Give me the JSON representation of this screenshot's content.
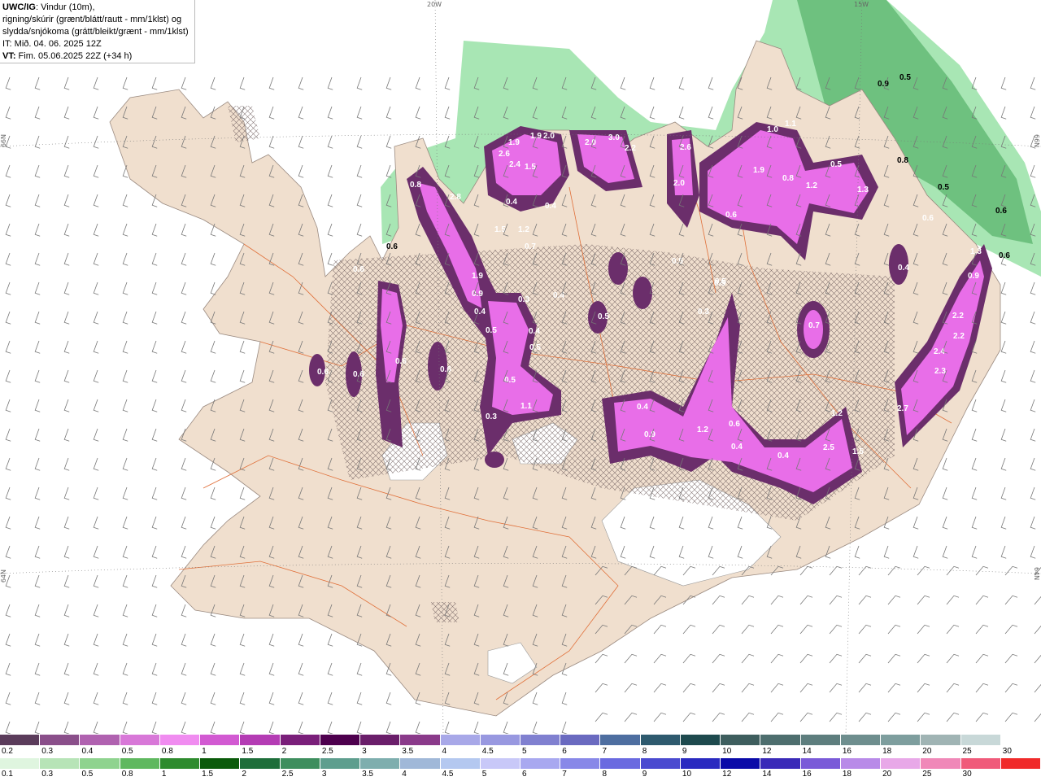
{
  "title": {
    "model": "UWC/IG",
    "line1_rest": ": Vindur (10m),",
    "line2": "rigning/skúrir (grænt/blátt/rautt - mm/1klst) og",
    "line3": "slydda/snjókoma (grátt/bleikt/grænt - mm/1klst)",
    "line4": "IT: Mið. 04. 06. 2025 12Z",
    "line5_label": "VT:",
    "line5_rest": " Fim. 05.06.2025 22Z (+34 h)"
  },
  "coords": {
    "top_20w": "20W",
    "top_15w": "15W",
    "left_66n": "66N",
    "right_66n": "66N",
    "left_64n": "64N",
    "right_64n": "64N"
  },
  "colors": {
    "sea": "#ffffff",
    "land": "#f0dfce",
    "glacier": "#ffffff",
    "roads": "#e0703a",
    "rain_light": "#a8e6b4",
    "rain_mid": "#5fb872",
    "snow_dark": "#6b2e6b",
    "snow_mid": "#a63aa6",
    "snow_light": "#e86ee8"
  },
  "precip_labels": [
    "2.6",
    "1.9",
    "1.9",
    "2.4",
    "1.5",
    "2.0",
    "2.0",
    "3.0",
    "2.2",
    "2.6",
    "2.0",
    "1.0",
    "1.1",
    "1.9",
    "1.2",
    "1.3",
    "0.8",
    "2.8",
    "1.5",
    "1.2",
    "0.7",
    "1.9",
    "0.4",
    "0.4",
    "0.3",
    "0.4",
    "0.5",
    "0.4",
    "0.4",
    "0.5",
    "0.5",
    "0.5",
    "0.5",
    "1.1",
    "0.3",
    "0.4",
    "0.9",
    "1.2",
    "0.6",
    "0.4",
    "2.5",
    "1.5",
    "1.2",
    "2.7",
    "2.3",
    "2.2",
    "2.2",
    "2.4",
    "1.3",
    "0.9",
    "0.6",
    "0.4",
    "0.7",
    "0.3",
    "0.6",
    "0.6",
    "0.6",
    "0.6",
    "0.6",
    "0.4",
    "0.5",
    "0.5",
    "0.5",
    "0.9",
    "0.8",
    "0.6"
  ],
  "sea_labels": [
    "0.5",
    "0.9",
    "0.8",
    "0.5",
    "0.6",
    "0.6",
    "0.6"
  ],
  "legend_snow": {
    "colors": [
      "#5b3c5b",
      "#8a4f8a",
      "#b062b0",
      "#d878d8",
      "#f08cf0",
      "#d25ad2",
      "#b43cb4",
      "#7a1f7a",
      "#4e004e",
      "#6a1e6a",
      "#8a3a8a",
      "#a8a8e8",
      "#9898e0",
      "#8080d0",
      "#6a6ac0",
      "#4e6ea0",
      "#2e5a6e",
      "#1e4a4e",
      "#3e5e5e",
      "#4e6e6e",
      "#5e7e7e",
      "#6e8e8e",
      "#7e9e9e",
      "#a0b4b4",
      "#c8d8d8",
      "#ffffff"
    ],
    "ticks": [
      "0.2",
      "0.3",
      "0.4",
      "0.5",
      "0.8",
      "1",
      "1.5",
      "2",
      "2.5",
      "3",
      "3.5",
      "4",
      "4.5",
      "5",
      "6",
      "7",
      "8",
      "9",
      "10",
      "12",
      "14",
      "16",
      "18",
      "20",
      "25",
      "30"
    ]
  },
  "legend_rain": {
    "colors": [
      "#dff5df",
      "#b7e4b7",
      "#8fd38f",
      "#5fb85f",
      "#2e8b2e",
      "#0a5a0a",
      "#1e6e3a",
      "#3e8e5e",
      "#5e9e8e",
      "#7eaeae",
      "#a0b8d8",
      "#b4c8f0",
      "#c8c8f8",
      "#a8a8f0",
      "#8888e8",
      "#6a6ae0",
      "#4a4ad0",
      "#2a2ac0",
      "#0a0aa8",
      "#3a2ab8",
      "#7a5ad8",
      "#b88ae8",
      "#e8a8e8",
      "#f088b8",
      "#f05a7a",
      "#f02a2a"
    ],
    "ticks": [
      "0.1",
      "0.3",
      "0.5",
      "0.8",
      "1",
      "1.5",
      "2",
      "2.5",
      "3",
      "3.5",
      "4",
      "4.5",
      "5",
      "6",
      "7",
      "8",
      "9",
      "10",
      "12",
      "14",
      "16",
      "18",
      "20",
      "25",
      "30"
    ]
  }
}
